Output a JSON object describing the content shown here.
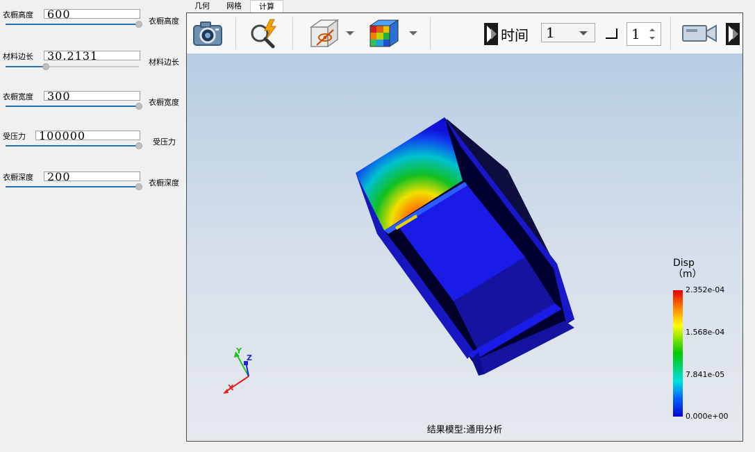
{
  "params": [
    {
      "label": "衣橱高度",
      "value": "600",
      "side": "衣橱高度",
      "fill": 1.0
    },
    {
      "label": "材料边长",
      "value": "30.2131",
      "side": "材料边长",
      "fill": 0.3
    },
    {
      "label": "衣橱宽度",
      "value": "300",
      "side": "衣橱宽度",
      "fill": 1.0
    },
    {
      "label": "受压力",
      "value": "100000",
      "side": "受压力",
      "fill": 1.0
    },
    {
      "label": "衣橱深度",
      "value": "200",
      "side": "衣橱深度",
      "fill": 1.0
    }
  ],
  "tabs": [
    "几何",
    "网格",
    "计算"
  ],
  "active_tab": "计算",
  "toolbar": {
    "time_label": "时间",
    "time_value": "1",
    "step_value": "1"
  },
  "viewport": {
    "result_label": "结果模型:通用分析",
    "axes": {
      "x": "X",
      "y": "Y",
      "z": "Z"
    }
  },
  "legend": {
    "title_line1": "Disp",
    "title_line2": "（m）",
    "ticks": [
      "2.352e-04",
      "1.568e-04",
      "7.841e-05",
      "0.000e+00"
    ]
  },
  "colors": {
    "slider_fill": "#1f6fb5",
    "model_blue": "#1010d8",
    "background_top": "#b7cde3",
    "background_bottom": "#e6e9ee"
  }
}
